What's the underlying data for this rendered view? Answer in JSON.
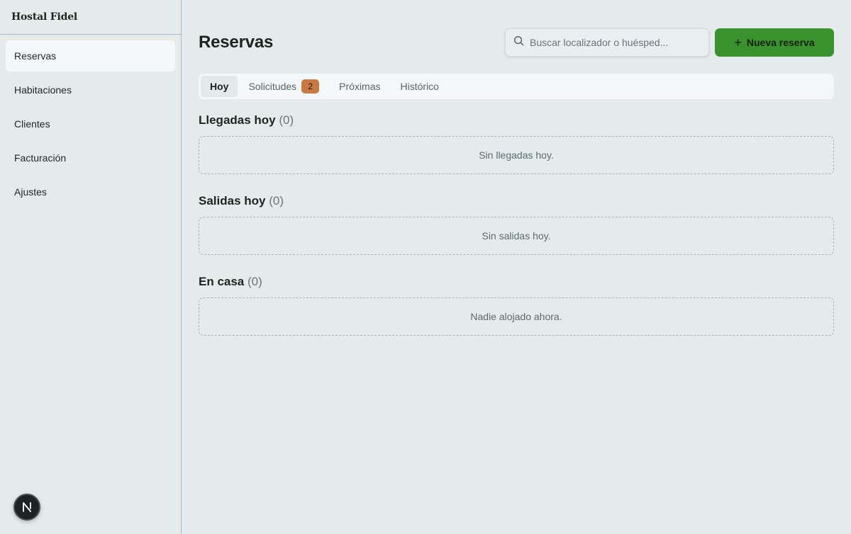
{
  "app": {
    "brand": "Hostal Fidel"
  },
  "sidebar": {
    "items": [
      {
        "label": "Reservas",
        "active": true
      },
      {
        "label": "Habitaciones"
      },
      {
        "label": "Clientes"
      },
      {
        "label": "Facturación"
      },
      {
        "label": "Ajustes"
      }
    ],
    "avatar_letter": "N"
  },
  "header": {
    "title": "Reservas",
    "search_placeholder": "Buscar localizador o huésped...",
    "new_button_label": "Nueva reserva"
  },
  "tabs": [
    {
      "label": "Hoy",
      "active": true
    },
    {
      "label": "Solicitudes",
      "badge": "2"
    },
    {
      "label": "Próximas"
    },
    {
      "label": "Histórico"
    }
  ],
  "sections": [
    {
      "title": "Llegadas hoy",
      "count": "(0)",
      "empty": "Sin llegadas hoy."
    },
    {
      "title": "Salidas hoy",
      "count": "(0)",
      "empty": "Sin salidas hoy."
    },
    {
      "title": "En casa",
      "count": "(0)",
      "empty": "Nadie alojado ahora."
    }
  ],
  "colors": {
    "accent": "#3a922f",
    "badge": "#c97a44",
    "background": "#e5ebeb"
  }
}
